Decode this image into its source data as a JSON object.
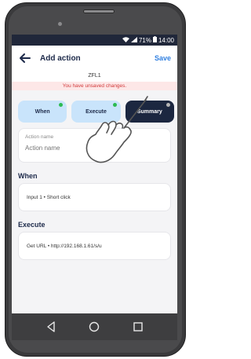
{
  "status_bar": {
    "signal": "71%",
    "time": "14:00"
  },
  "app_bar": {
    "title": "Add action",
    "save_label": "Save"
  },
  "device_name": "ZFL1",
  "unsaved_notice": "You have unsaved changes.",
  "tabs": [
    {
      "label": "When",
      "status": "done",
      "active": false
    },
    {
      "label": "Execute",
      "status": "done",
      "active": false
    },
    {
      "label": "Summary",
      "status": "pending",
      "active": true
    }
  ],
  "action_name": {
    "label": "Action name",
    "placeholder": "Action name",
    "value": ""
  },
  "when": {
    "title": "When",
    "value": "Input 1 • Short click"
  },
  "execute": {
    "title": "Execute",
    "value": "Get URL • http://192.168.1.61/s/u"
  },
  "colors": {
    "accent": "#2f7fe0",
    "tab_active": "#1c2740",
    "tab_inactive": "#c9e4fb",
    "ok_dot": "#2dbb52",
    "warning_text": "#d2393a"
  },
  "nav_icons": [
    "back-triangle-icon",
    "home-circle-icon",
    "recents-square-icon"
  ]
}
